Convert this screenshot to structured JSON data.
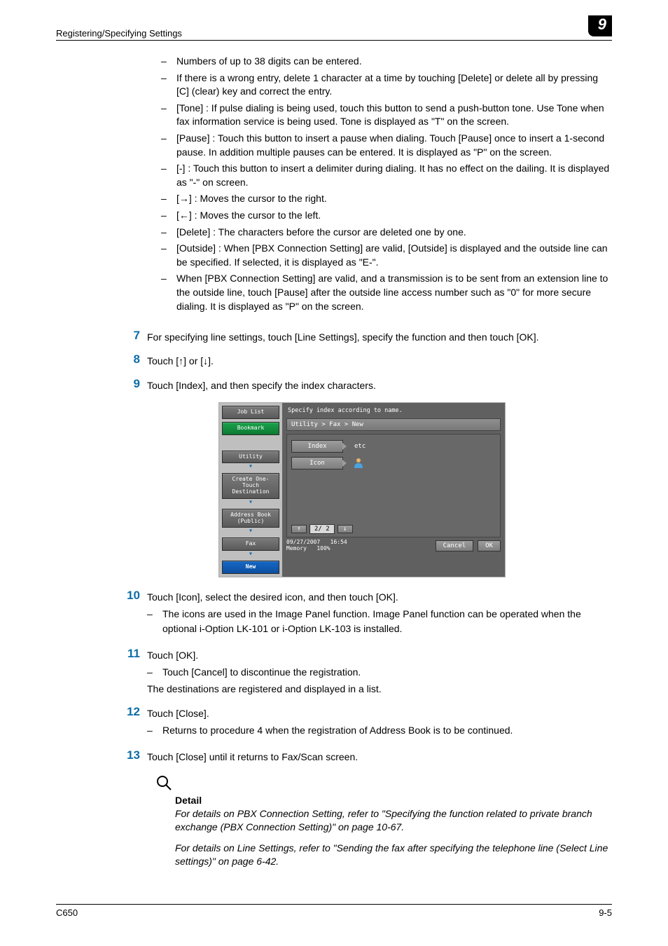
{
  "header": {
    "section_title": "Registering/Specifying Settings",
    "chapter_number": "9"
  },
  "bullets_top": [
    "Numbers of up to 38 digits can be entered.",
    "If there is a wrong entry, delete 1 character at a time by touching [Delete] or delete all by pressing [C] (clear) key and correct the entry.",
    "[Tone] : If pulse dialing is being used, touch this button to send a push-button tone. Use Tone when fax information service is being used. Tone is displayed as \"T\" on the screen.",
    "[Pause] : Touch this button to insert a pause when dialing. Touch [Pause] once to insert a 1-second pause. In addition multiple pauses can be entered. It is displayed as \"P\" on the screen.",
    "[-] : Touch this button to insert a delimiter during dialing. It has no effect on the dailing. It is displayed as \"-\" on screen.",
    "[→] : Moves the cursor to the right.",
    "[←] : Moves the cursor to the left.",
    "[Delete] : The characters before the cursor are deleted one by one.",
    "[Outside] : When [PBX Connection Setting] are valid, [Outside] is displayed and the outside line can be specified. If selected, it is displayed as \"E-\".",
    "When [PBX Connection Setting] are valid, and a transmission is to be sent from an extension line to the outside line, touch [Pause] after the outside line access number such as \"0\" for more secure dialing. It is displayed as \"P\" on the screen."
  ],
  "steps": {
    "7": {
      "text": "For specifying line settings, touch [Line Settings], specify the function and then touch [OK]."
    },
    "8": {
      "text": "Touch [↑] or [↓]."
    },
    "9": {
      "text": "Touch [Index], and then specify the index characters."
    },
    "10": {
      "text": "Touch [Icon], select the desired icon, and then touch [OK].",
      "sub": [
        "The icons are used in the Image Panel function. Image Panel function can be operated when the optional i-Option LK-101 or i-Option LK-103 is installed."
      ]
    },
    "11": {
      "text": "Touch [OK].",
      "sub": [
        "Touch [Cancel] to discontinue the registration."
      ],
      "plain": "The destinations are registered and displayed in a list."
    },
    "12": {
      "text": "Touch [Close].",
      "sub": [
        "Returns to procedure 4 when the registration of Address Book is to be continued."
      ]
    },
    "13": {
      "text": "Touch [Close] until it returns to Fax/Scan screen."
    }
  },
  "device": {
    "left_buttons": {
      "job_list": "Job List",
      "bookmark": "Bookmark",
      "utility": "Utility",
      "create": "Create One-Touch\nDestination",
      "address": "Address Book\n(Public)",
      "fax": "Fax",
      "new": "New"
    },
    "title": "Specify index according to name.",
    "breadcrumb": "Utility > Fax > New",
    "rows": {
      "index_label": "Index",
      "index_value": "etc",
      "icon_label": "Icon"
    },
    "pager": {
      "up": "↑",
      "value": "2/ 2",
      "down": "↓"
    },
    "footer": {
      "date": "09/27/2007",
      "time": "16:54",
      "mem_label": "Memory",
      "mem_value": "100%",
      "cancel": "Cancel",
      "ok": "OK"
    }
  },
  "detail": {
    "heading": "Detail",
    "p1": "For details on PBX Connection Setting, refer to \"Specifying the function related to private branch exchange (PBX Connection Setting)\" on page 10-67.",
    "p2": "For details on Line Settings, refer to \"Sending the fax after specifying the telephone line (Select Line settings)\" on page 6-42."
  },
  "footer": {
    "left": "C650",
    "right": "9-5"
  }
}
